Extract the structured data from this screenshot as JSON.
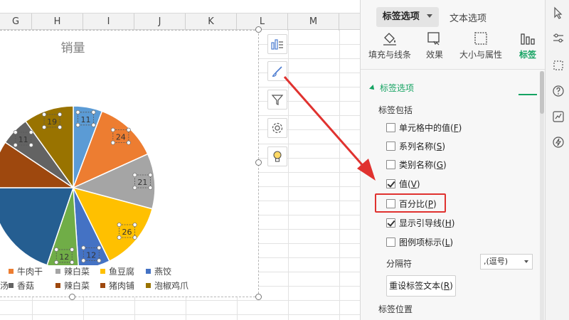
{
  "sheet": {
    "columns": [
      "G",
      "H",
      "I",
      "J",
      "K",
      "L",
      "M"
    ]
  },
  "chart": {
    "title": "销量",
    "chart_data": {
      "type": "pie",
      "title": "销量",
      "series": [
        {
          "name": "销量",
          "values": [
            11,
            24,
            21,
            26,
            12,
            12,
            38,
            18,
            11,
            19
          ]
        }
      ],
      "categories": [
        "燕饺",
        "牛肉干",
        "辣白菜",
        "鱼豆腐",
        "燕饺",
        "香菇",
        "辣白菜",
        "猪肉铺",
        "香菇",
        "泡椒鸡爪"
      ],
      "visible_slice_labels": [
        "11",
        "24",
        "21",
        "26",
        "12",
        "12",
        "11",
        "19"
      ],
      "colors": [
        "#5b9bd5",
        "#ed7d31",
        "#a5a5a5",
        "#ffc000",
        "#4472c4",
        "#70ad47",
        "#255e91",
        "#9e480e",
        "#636363",
        "#997300"
      ],
      "legend_position": "bottom"
    },
    "legend": {
      "row1": [
        {
          "label": "牛肉干",
          "color": "#ed7d31"
        },
        {
          "label": "辣白菜",
          "color": "#a5a5a5"
        },
        {
          "label": "鱼豆腐",
          "color": "#ffc000"
        },
        {
          "label": "燕饺",
          "color": "#4472c4"
        }
      ],
      "row1_partial": "",
      "row2_partial": "汤",
      "row2": [
        {
          "label": "香菇",
          "color": "#636363"
        },
        {
          "label": "辣白菜",
          "color": "#9e480e"
        },
        {
          "label": "猪肉铺",
          "color": "#9e480e"
        },
        {
          "label": "泡椒鸡爪",
          "color": "#997300"
        }
      ]
    }
  },
  "panel": {
    "tab_label_options": "标签选项",
    "tab_text_options": "文本选项",
    "subtabs": {
      "fill": "填充与线条",
      "effect": "效果",
      "size": "大小与属性",
      "label": "标签"
    },
    "section_title": "标签选项",
    "contains_label": "标签包括",
    "checkboxes": [
      {
        "text": "单元格中的值(",
        "key": "F",
        "checked": false
      },
      {
        "text": "系列名称(",
        "key": "S",
        "checked": false
      },
      {
        "text": "类别名称(",
        "key": "G",
        "checked": false
      },
      {
        "text": "值(",
        "key": "V",
        "checked": true
      },
      {
        "text": "百分比(",
        "key": "P",
        "checked": false
      },
      {
        "text": "显示引导线(",
        "key": "H",
        "checked": true
      },
      {
        "text": "图例项标示(",
        "key": "L",
        "checked": false
      }
    ],
    "close_paren": ")",
    "separator_label": "分隔符",
    "separator_value": ",(逗号)",
    "reset_text_button": "重设标签文本(",
    "reset_key": "R",
    "label_position": "标签位置"
  },
  "colors": {
    "accent": "#15a362",
    "highlight": "#e0322f"
  }
}
